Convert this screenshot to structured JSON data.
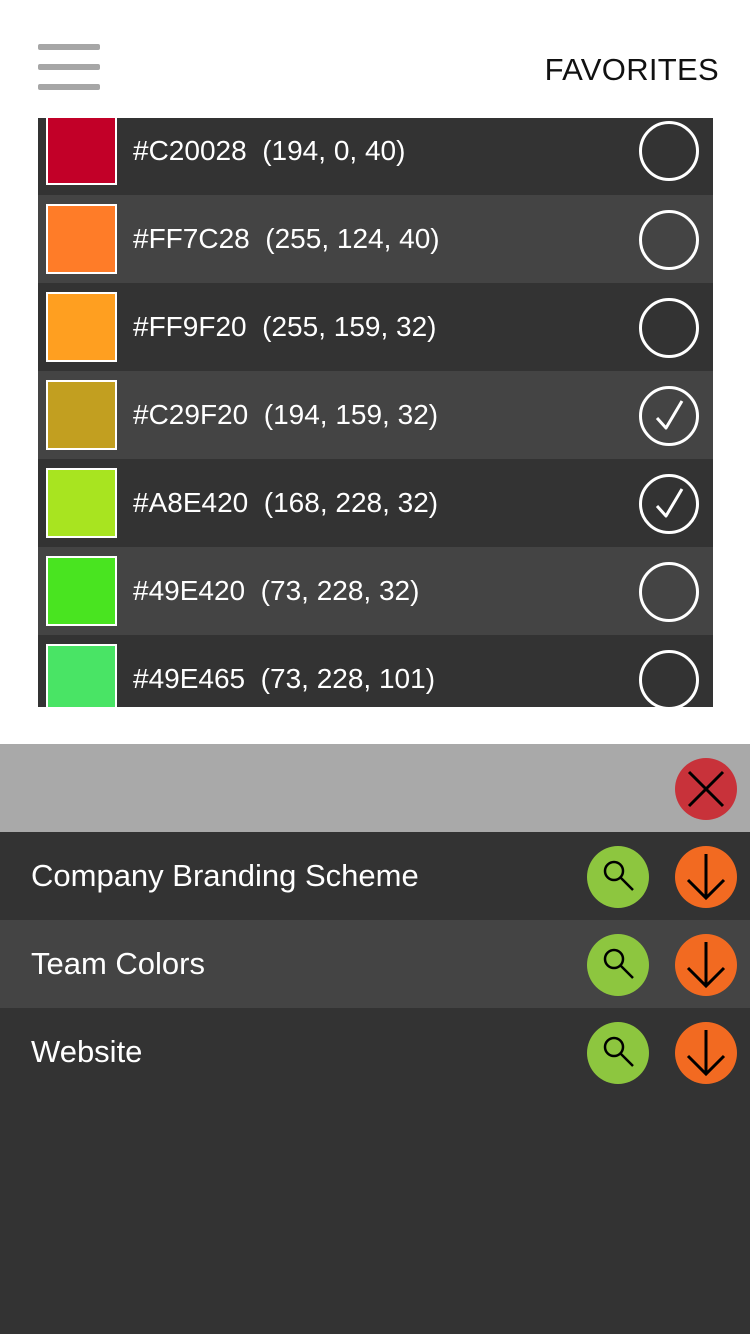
{
  "header": {
    "title": "FAVORITES",
    "menu_icon": "hamburger-menu-icon"
  },
  "colors": [
    {
      "hex": "#C20028",
      "rgb": "(194, 0, 40)",
      "swatch": "#C20028",
      "selected": false
    },
    {
      "hex": "#FF7C28",
      "rgb": "(255, 124, 40)",
      "swatch": "#FF7C28",
      "selected": false
    },
    {
      "hex": "#FF9F20",
      "rgb": "(255, 159, 32)",
      "swatch": "#FF9F20",
      "selected": false
    },
    {
      "hex": "#C29F20",
      "rgb": "(194, 159, 32)",
      "swatch": "#C29F20",
      "selected": true
    },
    {
      "hex": "#A8E420",
      "rgb": "(168, 228, 32)",
      "swatch": "#A8E420",
      "selected": true
    },
    {
      "hex": "#49E420",
      "rgb": "(73, 228, 32)",
      "swatch": "#49E420",
      "selected": false
    },
    {
      "hex": "#49E465",
      "rgb": "(73, 228, 101)",
      "swatch": "#49E465",
      "selected": false
    }
  ],
  "panel": {
    "close_icon": "close-icon",
    "close_color": "#c8323a",
    "schemes": [
      {
        "name": "Company Branding Scheme"
      },
      {
        "name": "Team Colors"
      },
      {
        "name": "Website"
      }
    ],
    "view_icon": "magnifier-icon",
    "view_color": "#8dc63f",
    "download_icon": "arrow-down-icon",
    "download_color": "#f26a21"
  }
}
